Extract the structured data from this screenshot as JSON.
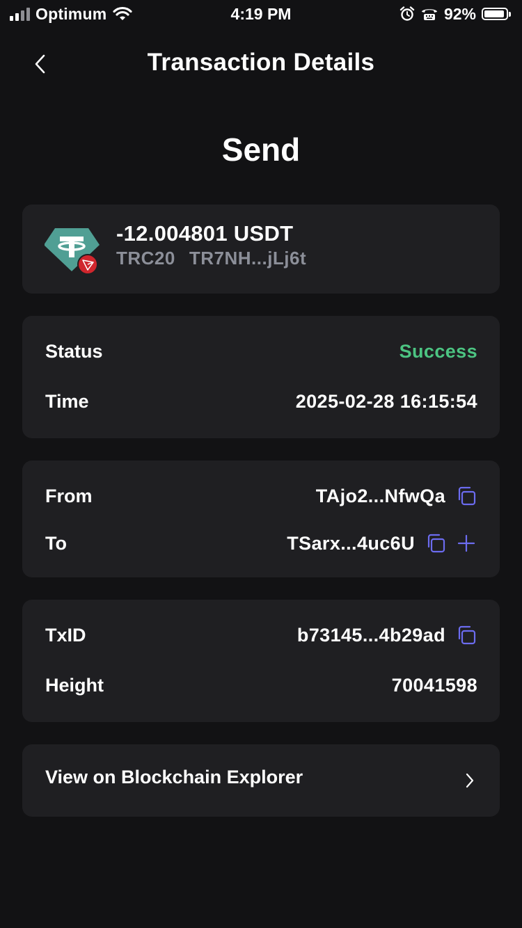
{
  "status_bar": {
    "carrier": "Optimum",
    "time": "4:19 PM",
    "battery": "92%"
  },
  "header": {
    "title": "Transaction Details",
    "back_icon": "chevron-left-icon"
  },
  "page": {
    "heading": "Send"
  },
  "token": {
    "amount": "-12.004801 USDT",
    "network": "TRC20",
    "address": "TR7NH...jLj6t",
    "logo_icon": "tether-icon",
    "badge_icon": "tron-icon",
    "colors": {
      "logo": "#509f94",
      "badge": "#d0262d"
    }
  },
  "status_card": {
    "status_label": "Status",
    "status_value": "Success",
    "time_label": "Time",
    "time_value": "2025-02-28 16:15:54"
  },
  "address_card": {
    "from_label": "From",
    "from_value": "TAjo2...NfwQa",
    "to_label": "To",
    "to_value": "TSarx...4uc6U"
  },
  "tx_card": {
    "txid_label": "TxID",
    "txid_value": "b73145...4b29ad",
    "height_label": "Height",
    "height_value": "70041598"
  },
  "explorer": {
    "label": "View on Blockchain Explorer"
  },
  "colors": {
    "background": "#121214",
    "card": "#1f1f22",
    "success": "#4cc482",
    "accent_icon": "#6c6cf0",
    "muted_text": "#8c8f99"
  }
}
